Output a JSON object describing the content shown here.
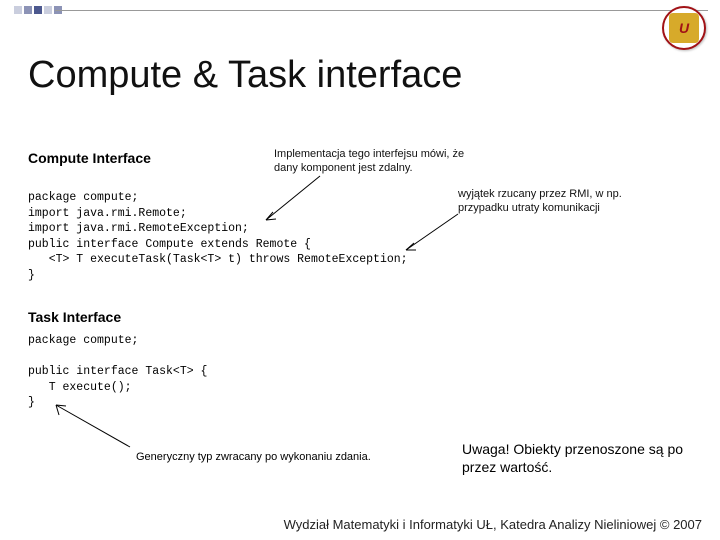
{
  "title": "Compute & Task interface",
  "sections": {
    "compute_heading": "Compute Interface",
    "task_heading": "Task Interface"
  },
  "annotations": {
    "impl_note": "Implementacja tego interfejsu mówi, że dany komponent jest zdalny.",
    "exception_note": "wyjątek rzucany przez RMI, w np. przypadku utraty komunikacji",
    "generic_note": "Generyczny typ zwracany po wykonaniu zdania.",
    "caution": "Uwaga! Obiekty przenoszone są po przez wartość."
  },
  "code": {
    "compute": "package compute;\nimport java.rmi.Remote;\nimport java.rmi.RemoteException;\npublic interface Compute extends Remote {\n   <T> T executeTask(Task<T> t) throws RemoteException;\n}",
    "task": "package compute;\n\npublic interface Task<T> {\n   T execute();\n}"
  },
  "footer": "Wydział Matematyki i Informatyki UŁ, Katedra Analizy Nieliniowej © 2007",
  "logo_text": "U"
}
